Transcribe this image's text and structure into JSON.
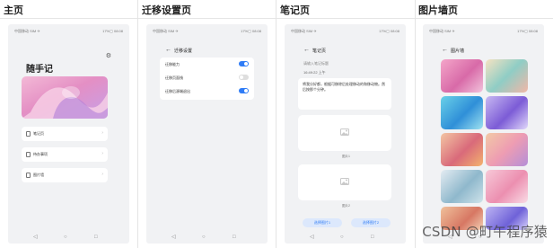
{
  "columns": [
    {
      "title": "主页"
    },
    {
      "title": "迁移设置页"
    },
    {
      "title": "笔记页"
    },
    {
      "title": "图片墙页"
    }
  ],
  "status": {
    "left": "中国移动 SIM ✈",
    "right": "17%▢ 08:08"
  },
  "home": {
    "app_title": "随手记",
    "menu": [
      {
        "label": "笔记页",
        "icon": "note-icon"
      },
      {
        "label": "待办事项",
        "icon": "todo-icon"
      },
      {
        "label": "图片墙",
        "icon": "image-icon"
      }
    ]
  },
  "settings": {
    "title": "迁移设置",
    "rows": [
      {
        "label": "迁移能力",
        "on": true
      },
      {
        "label": "迁移页面栈",
        "on": false
      },
      {
        "label": "迁移后源端退出",
        "on": true
      }
    ]
  },
  "note": {
    "title": "笔记页",
    "placeholder": "请输入笔记标题",
    "time": "16:49:22 上午",
    "body": "将我分好都，根据可移除后处理移动的和移动物。然后按那个分钟。",
    "image1_caption": "图片1",
    "image2_caption": "图片2",
    "pick1": "选择图片1",
    "pick2": "选择图片2"
  },
  "gallery": {
    "title": "图片墙"
  },
  "watermark": "CSDN @町午程序猿",
  "colors": {
    "accent": "#2f7cf6",
    "background": "#f1f2f4"
  }
}
